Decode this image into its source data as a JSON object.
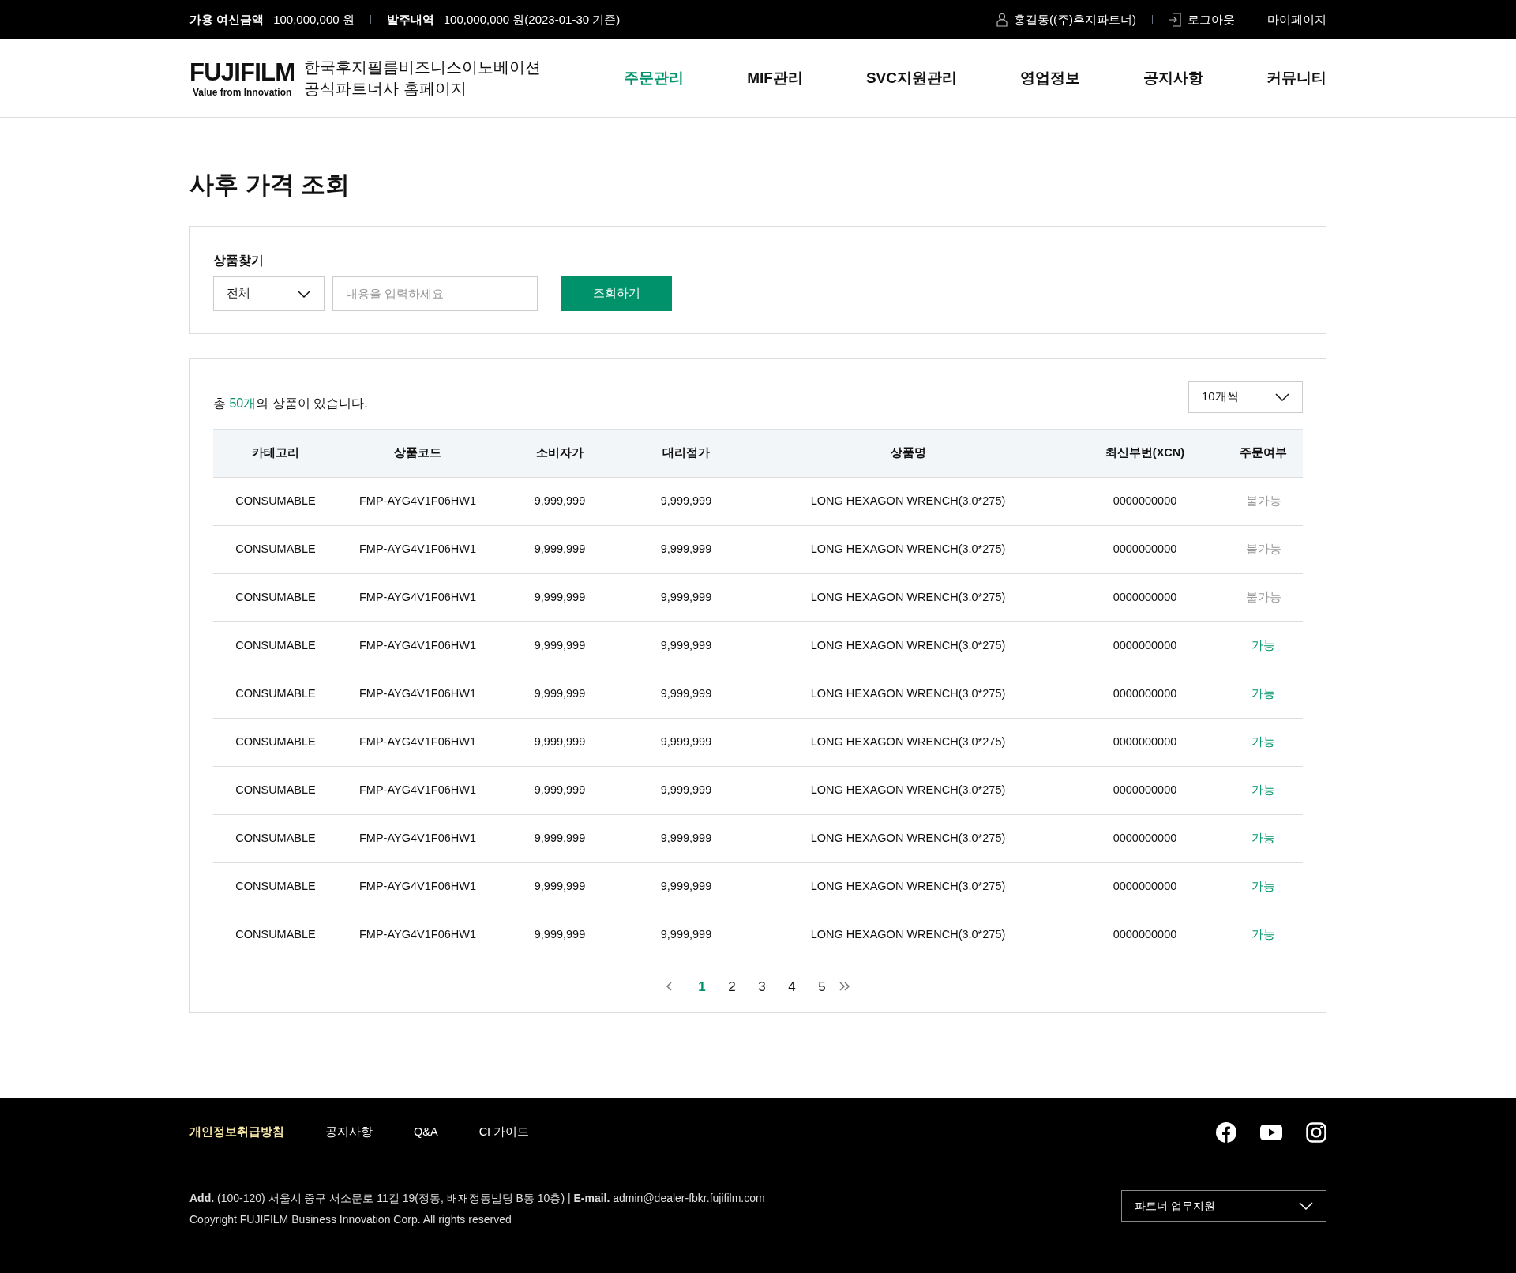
{
  "top_bar": {
    "credit_label": "가용 여신금액",
    "credit_value": "100,000,000 원",
    "order_label": "발주내역",
    "order_value": "100,000,000 원(2023-01-30 기준)",
    "user": "홍길동((주)후지파트너)",
    "logout": "로그아웃",
    "mypage": "마이페이지"
  },
  "header": {
    "logo": "FUJIFILM",
    "logo_tagline": "Value from Innovation",
    "site_title_1": "한국후지필름비즈니스이노베이션",
    "site_title_2": "공식파트너사 홈페이지",
    "nav": [
      {
        "label": "주문관리",
        "selected": true
      },
      {
        "label": "MIF관리",
        "selected": false
      },
      {
        "label": "SVC지원관리",
        "selected": false
      },
      {
        "label": "영업정보",
        "selected": false
      },
      {
        "label": "공지사항",
        "selected": false
      },
      {
        "label": "커뮤니티",
        "selected": false
      }
    ]
  },
  "page_title": "사후 가격 조회",
  "search": {
    "label": "상품찾기",
    "category": "전체",
    "placeholder": "내용을 입력하세요",
    "button": "조회하기"
  },
  "results": {
    "summary": "총 **50개**의 상품이 있습니다.",
    "page_size": "10개씩",
    "columns": [
      "카테고리",
      "상품코드",
      "소비자가",
      "대리점가",
      "상품명",
      "최신부번(XCN)",
      "주문여부"
    ],
    "rows": [
      {
        "cells": [
          "CONSUMABLE",
          "FMP-AYG4V1F06HW1",
          "9,999,999",
          "9,999,999",
          "LONG HEXAGON WRENCH(3.0*275)",
          "0000000000"
        ],
        "status": "불가능",
        "available": false
      },
      {
        "cells": [
          "CONSUMABLE",
          "FMP-AYG4V1F06HW1",
          "9,999,999",
          "9,999,999",
          "LONG HEXAGON WRENCH(3.0*275)",
          "0000000000"
        ],
        "status": "불가능",
        "available": false
      },
      {
        "cells": [
          "CONSUMABLE",
          "FMP-AYG4V1F06HW1",
          "9,999,999",
          "9,999,999",
          "LONG HEXAGON WRENCH(3.0*275)",
          "0000000000"
        ],
        "status": "불가능",
        "available": false
      },
      {
        "cells": [
          "CONSUMABLE",
          "FMP-AYG4V1F06HW1",
          "9,999,999",
          "9,999,999",
          "LONG HEXAGON WRENCH(3.0*275)",
          "0000000000"
        ],
        "status": "가능",
        "available": true
      },
      {
        "cells": [
          "CONSUMABLE",
          "FMP-AYG4V1F06HW1",
          "9,999,999",
          "9,999,999",
          "LONG HEXAGON WRENCH(3.0*275)",
          "0000000000"
        ],
        "status": "가능",
        "available": true
      },
      {
        "cells": [
          "CONSUMABLE",
          "FMP-AYG4V1F06HW1",
          "9,999,999",
          "9,999,999",
          "LONG HEXAGON WRENCH(3.0*275)",
          "0000000000"
        ],
        "status": "가능",
        "available": true
      },
      {
        "cells": [
          "CONSUMABLE",
          "FMP-AYG4V1F06HW1",
          "9,999,999",
          "9,999,999",
          "LONG HEXAGON WRENCH(3.0*275)",
          "0000000000"
        ],
        "status": "가능",
        "available": true
      },
      {
        "cells": [
          "CONSUMABLE",
          "FMP-AYG4V1F06HW1",
          "9,999,999",
          "9,999,999",
          "LONG HEXAGON WRENCH(3.0*275)",
          "0000000000"
        ],
        "status": "가능",
        "available": true
      },
      {
        "cells": [
          "CONSUMABLE",
          "FMP-AYG4V1F06HW1",
          "9,999,999",
          "9,999,999",
          "LONG HEXAGON WRENCH(3.0*275)",
          "0000000000"
        ],
        "status": "가능",
        "available": true
      },
      {
        "cells": [
          "CONSUMABLE",
          "FMP-AYG4V1F06HW1",
          "9,999,999",
          "9,999,999",
          "LONG HEXAGON WRENCH(3.0*275)",
          "0000000000"
        ],
        "status": "가능",
        "available": true
      }
    ],
    "pagination": [
      {
        "label": "1",
        "selected": true
      },
      {
        "label": "2",
        "selected": false
      },
      {
        "label": "3",
        "selected": false
      },
      {
        "label": "4",
        "selected": false
      },
      {
        "label": "5",
        "selected": false
      }
    ]
  },
  "footer": {
    "links": [
      {
        "label": "개인정보취급방침",
        "highlighted": true
      },
      {
        "label": "공지사항",
        "highlighted": false
      },
      {
        "label": "Q&A",
        "highlighted": false
      },
      {
        "label": "CI 가이드",
        "highlighted": false
      }
    ],
    "address": "**Add.** (100-120) 서울시 중구 서소문로 11길 19(정동, 배재정동빌딩 B동 10층) | **E-mail.** admin@dealer-fbkr.fujifilm.com",
    "copyright": "Copyright FUJIFILM Business Innovation Corp. All rights reserved",
    "family_site": "파트너 업무지원"
  }
}
